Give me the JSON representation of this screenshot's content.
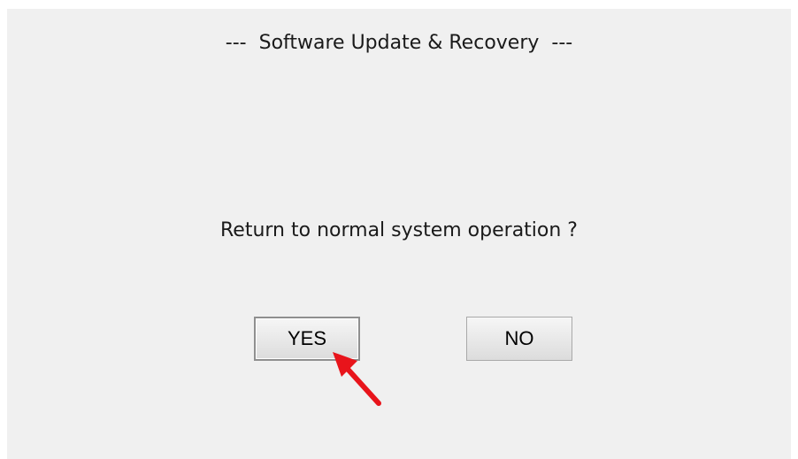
{
  "dialog": {
    "title": "---  Software Update & Recovery  ---",
    "question": "Return to normal system operation ?",
    "yes_label": "YES",
    "no_label": "NO"
  },
  "annotation": {
    "icon": "red-arrow-icon",
    "color": "#e8141b"
  }
}
